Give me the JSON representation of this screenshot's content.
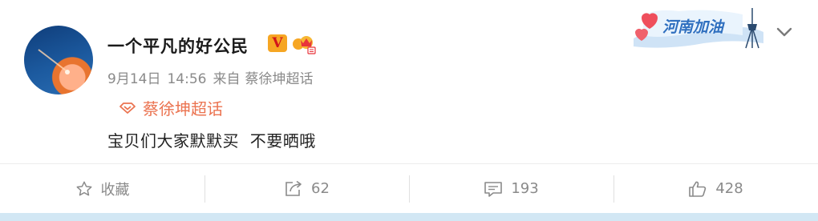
{
  "post": {
    "username": "一个平凡的好公民",
    "verified_badge": "V",
    "date": "9月14日",
    "time": "14:56",
    "from_label": "来自",
    "source": "蔡徐坤超话",
    "topic_label": "蔡徐坤超话",
    "content": "宝贝们大家默默买  不要晒哦",
    "event_badge_text": "河南加油"
  },
  "actions": {
    "favorite_label": "收藏",
    "repost_count": "62",
    "comment_count": "193",
    "like_count": "428"
  },
  "icons": {
    "avatar": "avatar-image",
    "crown": "crown-icon",
    "topic": "super-topic-icon",
    "chevron": "chevron-down-icon",
    "favorite": "star-icon",
    "repost": "repost-icon",
    "comment": "comment-icon",
    "like": "thumbs-up-icon"
  },
  "colors": {
    "topic_accent": "#eb7350",
    "verified_badge_bg": "#f6a623",
    "verified_badge_fg": "#d1141b",
    "meta_text": "#8a8a8a",
    "bottom_strip": "#d2e7f4"
  }
}
